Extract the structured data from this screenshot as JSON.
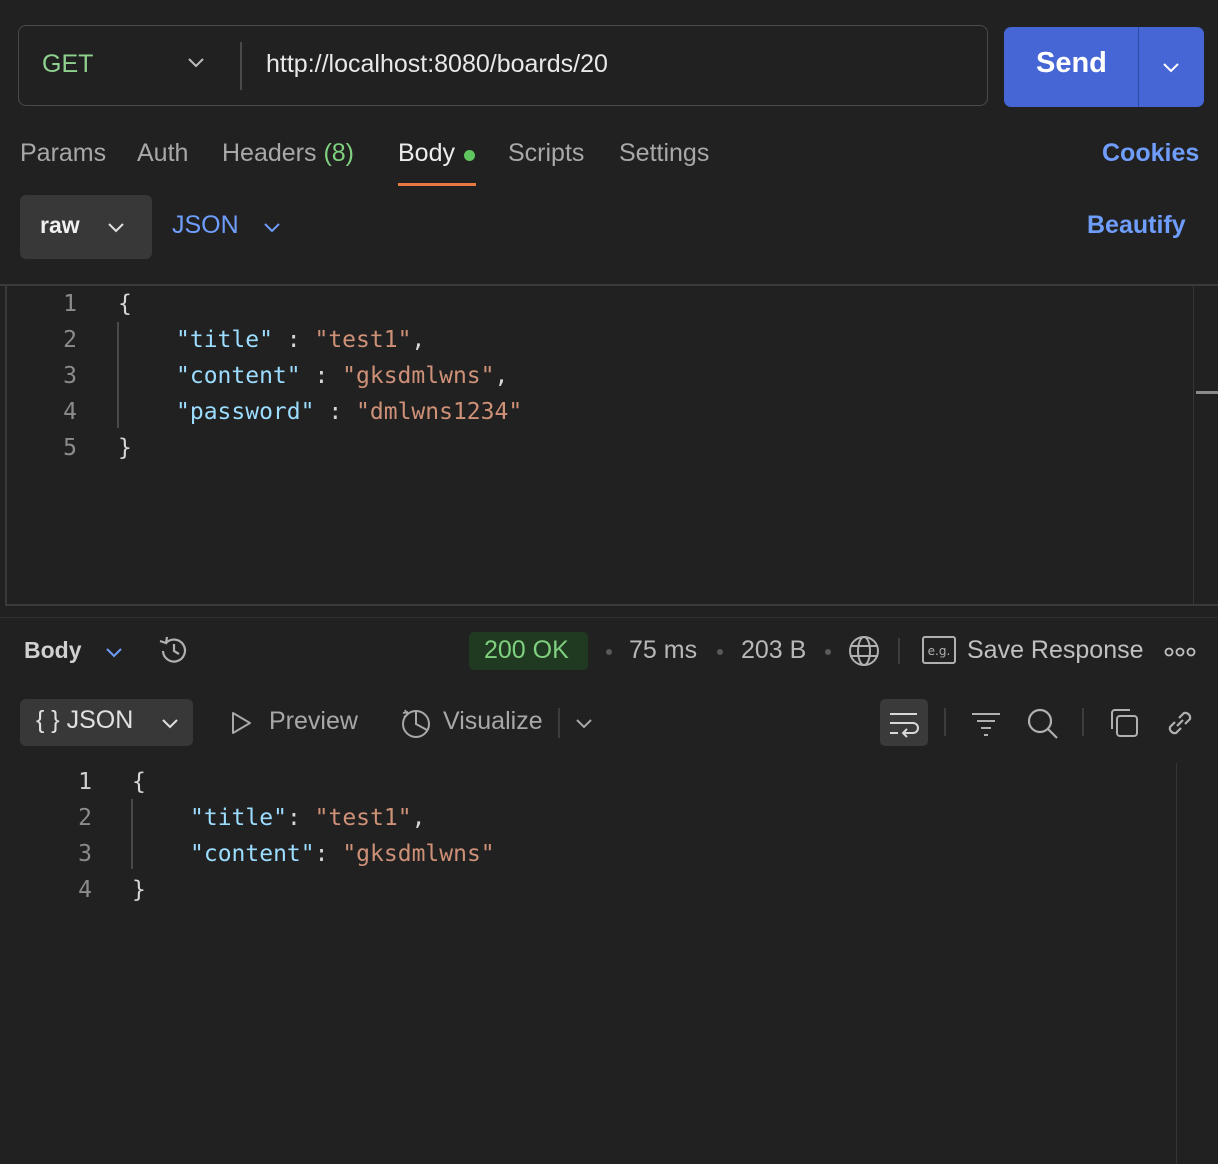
{
  "request": {
    "method": "GET",
    "url": "http://localhost:8080/boards/20",
    "send_label": "Send"
  },
  "tabs": {
    "params": "Params",
    "auth": "Auth",
    "headers": "Headers",
    "headers_count": "(8)",
    "body": "Body",
    "scripts": "Scripts",
    "settings": "Settings",
    "cookies": "Cookies"
  },
  "body_mode": {
    "mode": "raw",
    "format": "JSON",
    "beautify": "Beautify"
  },
  "request_body": {
    "line_numbers": [
      "1",
      "2",
      "3",
      "4",
      "5"
    ],
    "open_brace": "{",
    "close_brace": "}",
    "lines": [
      {
        "key": "\"title\"",
        "sep": " : ",
        "value": "\"test1\"",
        "trail": ","
      },
      {
        "key": "\"content\"",
        "sep": " : ",
        "value": "\"gksdmlwns\"",
        "trail": ","
      },
      {
        "key": "\"password\"",
        "sep": " : ",
        "value": "\"dmlwns1234\"",
        "trail": ""
      }
    ]
  },
  "response": {
    "section_label": "Body",
    "status": "200 OK",
    "time": "75 ms",
    "size": "203 B",
    "save_response": "Save Response",
    "eg_icon_text": "e.g.",
    "format_icon": "{ }",
    "format": "JSON",
    "preview": "Preview",
    "visualize": "Visualize",
    "line_numbers": [
      "1",
      "2",
      "3",
      "4"
    ],
    "open_brace": "{",
    "close_brace": "}",
    "lines": [
      {
        "key": "\"title\"",
        "sep": ": ",
        "value": "\"test1\"",
        "trail": ","
      },
      {
        "key": "\"content\"",
        "sep": ": ",
        "value": "\"gksdmlwns\"",
        "trail": ""
      }
    ]
  },
  "colors": {
    "accent_blue": "#6f9dfb",
    "send_button": "#4666d6",
    "method_green": "#8fd18f",
    "status_bg": "#203a22",
    "tab_underline": "#e87a41",
    "json_key": "#9cdcfe",
    "json_string": "#ce9178"
  }
}
